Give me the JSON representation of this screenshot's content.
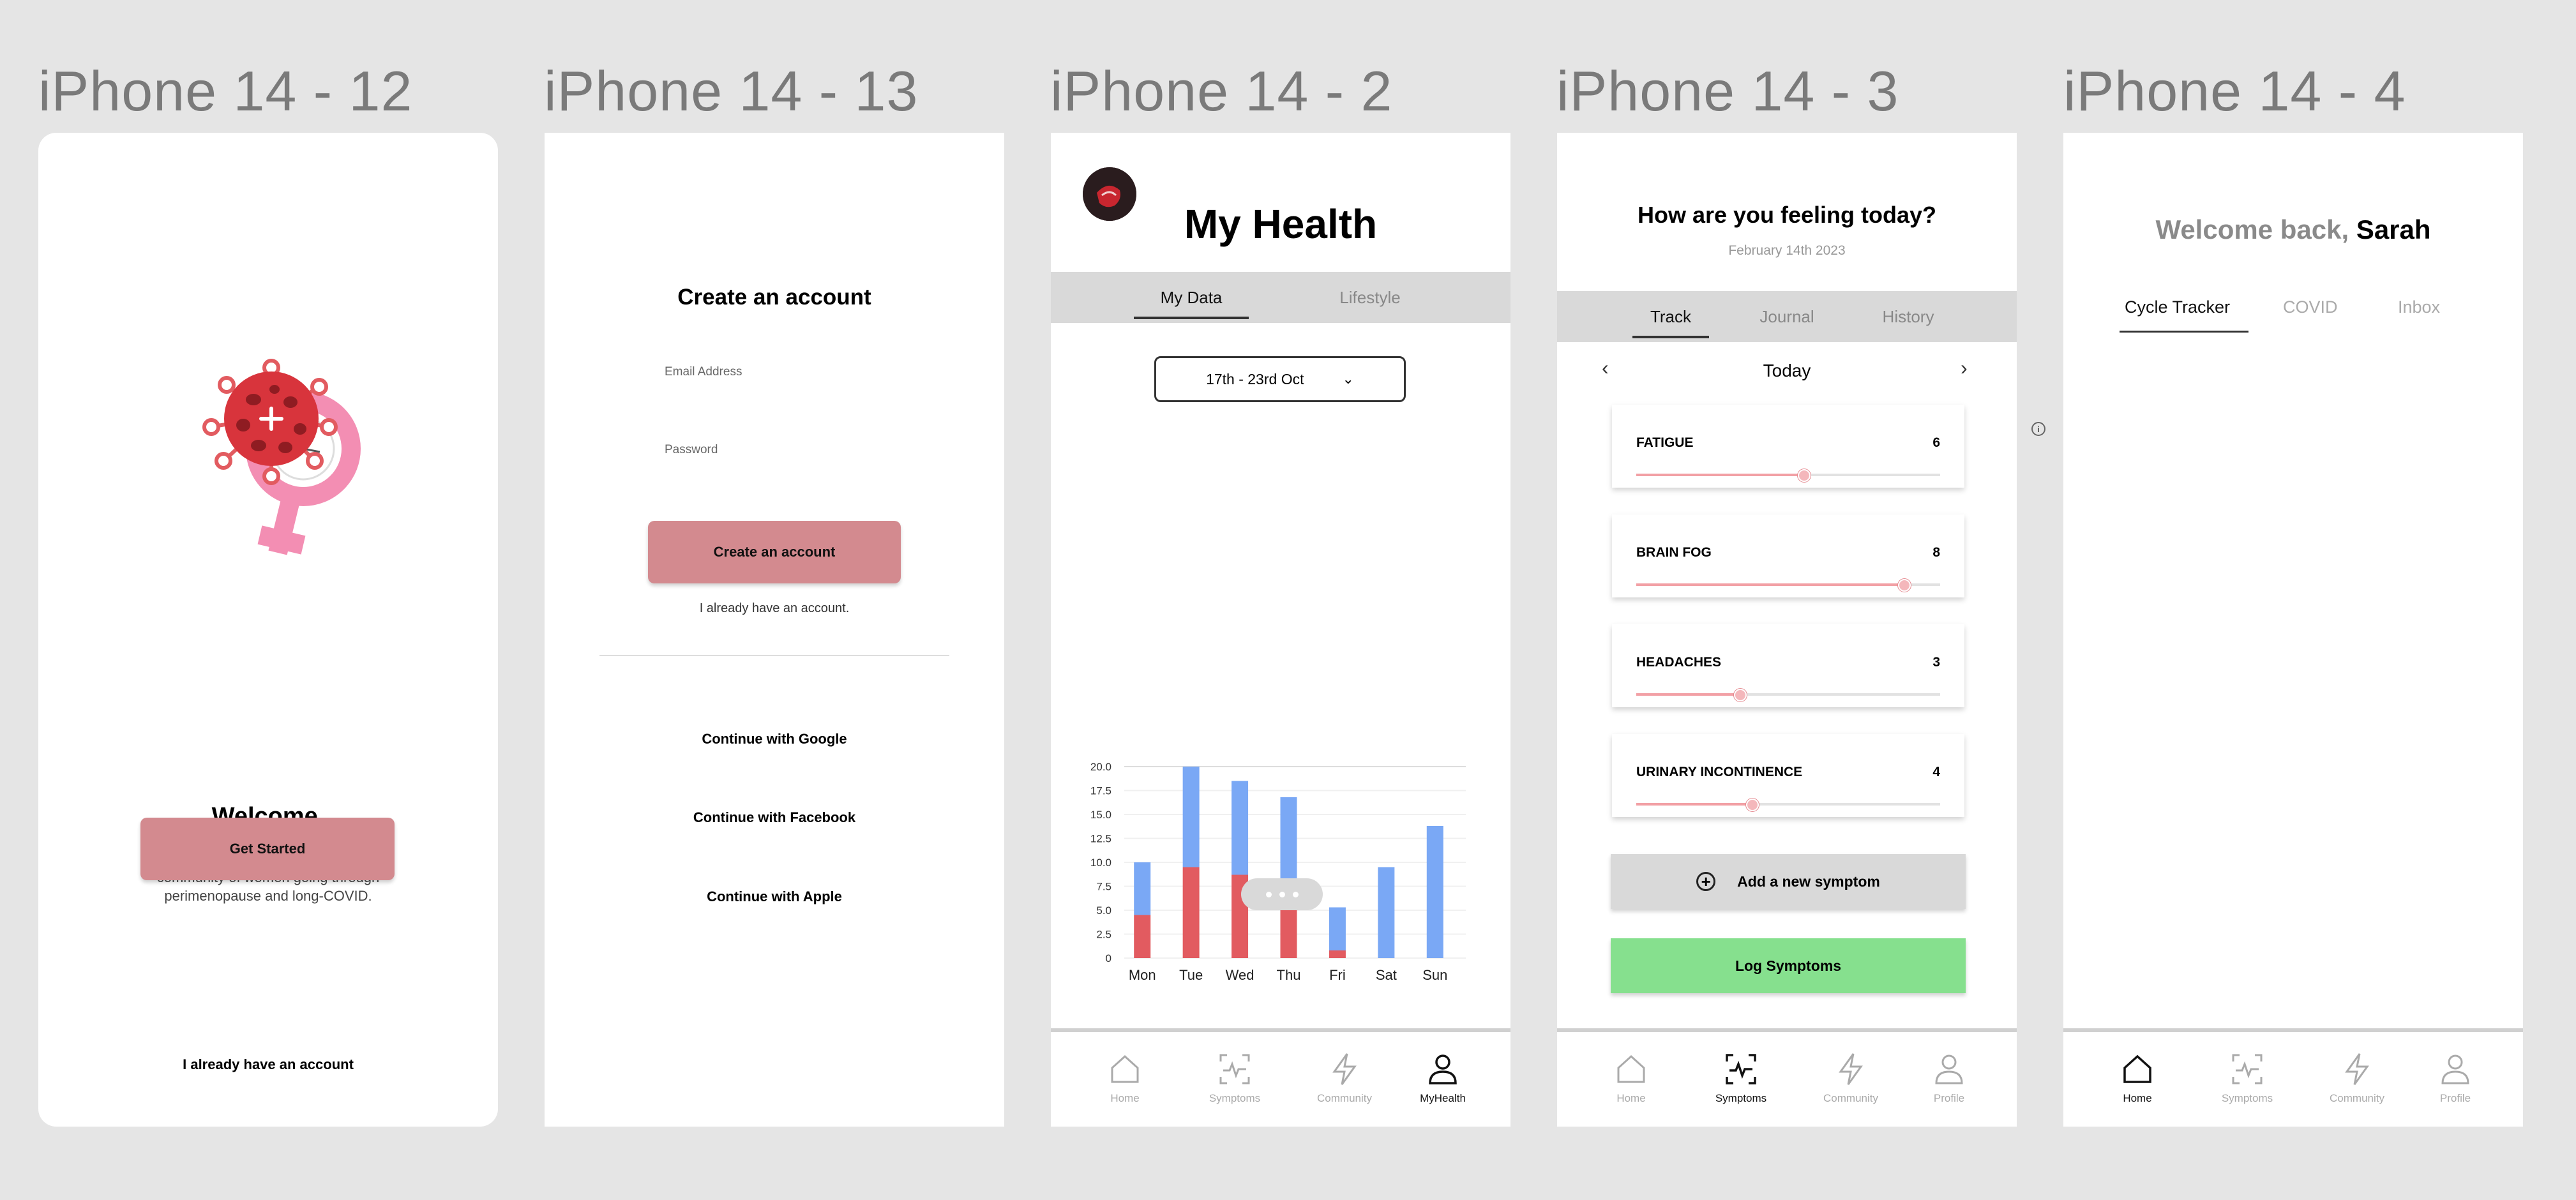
{
  "frames": [
    {
      "title": "iPhone 14 - 12"
    },
    {
      "title": "iPhone 14 - 13"
    },
    {
      "title": "iPhone 14 - 2"
    },
    {
      "title": "iPhone 14 - 3"
    },
    {
      "title": "iPhone 14 - 4"
    }
  ],
  "welcome": {
    "heading": "Welcome.",
    "description": "Track your symptoms and find a community of women going through perimenopause and long-COVID.",
    "get_started": "Get Started",
    "have_account": "I already have an account"
  },
  "signup": {
    "title": "Create an account",
    "email_label": "Email Address",
    "password_label": "Password",
    "create_button": "Create an account",
    "have_account": "I already have an account.",
    "google": "Continue with Google",
    "facebook": "Continue with Facebook",
    "apple": "Continue with Apple"
  },
  "health": {
    "title": "My Health",
    "tabs": [
      "My Data",
      "Lifestyle"
    ],
    "date_range": "17th - 23rd Oct"
  },
  "chart_data": {
    "type": "bar",
    "stacked": true,
    "categories": [
      "Mon",
      "Tue",
      "Wed",
      "Thu",
      "Fri",
      "Sat",
      "Sun"
    ],
    "series": [
      {
        "color": "#e25b60",
        "values": [
          4.5,
          9.5,
          8.7,
          8.0,
          0.8,
          0,
          0
        ]
      },
      {
        "color": "#7aa8f5",
        "values": [
          5.5,
          10.5,
          9.8,
          8.8,
          4.5,
          9.5,
          13.8
        ]
      }
    ],
    "yticks": [
      "20.0",
      "17.5",
      "15.0",
      "12.5",
      "10.0",
      "7.5",
      "5.0",
      "2.5",
      "0"
    ],
    "ylim": [
      0,
      20
    ],
    "grid": true
  },
  "symptoms": {
    "question": "How are you feeling today?",
    "date": "February 14th 2023",
    "tabs": [
      "Track",
      "Journal",
      "History"
    ],
    "day": "Today",
    "items": [
      {
        "name": "FATIGUE",
        "value": "6",
        "level": 0.55
      },
      {
        "name": "BRAIN FOG",
        "value": "8",
        "level": 0.88
      },
      {
        "name": "HEADACHES",
        "value": "3",
        "level": 0.34
      },
      {
        "name": "URINARY INCONTINENCE",
        "value": "4",
        "level": 0.38
      }
    ],
    "add_button": "Add a new symptom",
    "log_button": "Log Symptoms"
  },
  "home": {
    "welcome": "Welcome back,",
    "name": "Sarah",
    "tabs": [
      "Cycle Tracker",
      "COVID",
      "Inbox"
    ]
  },
  "nav": {
    "health_labels": [
      "Home",
      "Symptoms",
      "Community",
      "MyHealth"
    ],
    "app_labels": [
      "Home",
      "Symptoms",
      "Community",
      "Profile"
    ]
  },
  "side_icon": "i"
}
